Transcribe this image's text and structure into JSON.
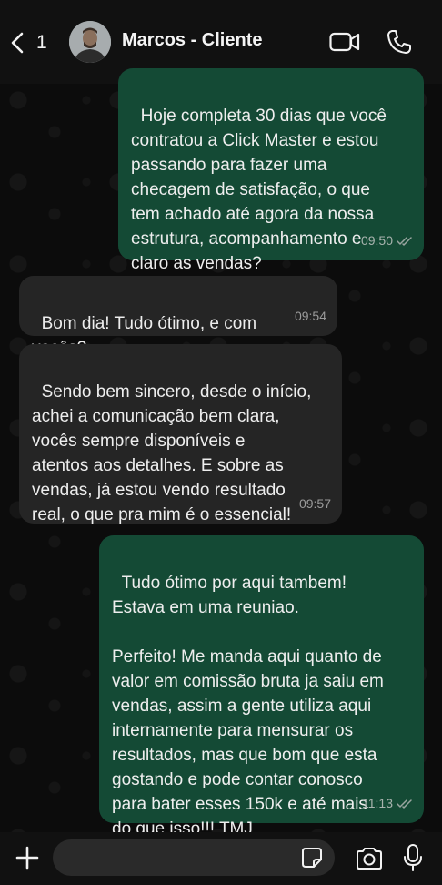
{
  "header": {
    "back_count": "1",
    "contact_name": "Marcos - Cliente"
  },
  "messages": [
    {
      "direction": "outgoing",
      "text": "Hoje completa 30 dias que você\ncontratou a Click Master e estou\npassando para fazer uma\nchecagem de satisfação, o que\ntem achado até agora da nossa\nestrutura, acompanhamento e\nclaro as vendas?",
      "time": "09:50",
      "status": "read"
    },
    {
      "direction": "incoming",
      "text": "Bom dia! Tudo ótimo, e com\nvocês?",
      "time": "09:54"
    },
    {
      "direction": "incoming",
      "text": "Sendo bem sincero, desde o início,\nachei a comunicação bem clara,\nvocês sempre disponíveis e\natentos aos detalhes. E sobre as\nvendas, já estou vendo resultado\nreal, o que pra mim é o essencial!",
      "time": "09:57"
    },
    {
      "direction": "outgoing",
      "text": "Tudo ótimo por aqui tambem!\nEstava em uma reuniao.\n\nPerfeito! Me manda aqui quanto de\nvalor em comissão bruta ja saiu em\nvendas, assim a gente utiliza aqui\ninternamente para mensurar os\nresultados, mas que bom que esta\ngostando e pode contar conosco\npara bater esses 150k e até mais\ndo que isso!!! TMJ",
      "time": "11:13",
      "status": "read"
    }
  ],
  "composer": {
    "value": ""
  },
  "colors": {
    "outgoing_bubble": "#144a35",
    "incoming_bubble": "#252525",
    "read_ticks": "#9aa5a0"
  },
  "icons": [
    "chevron-left-icon",
    "video-camera-icon",
    "phone-icon",
    "plus-icon",
    "sticker-icon",
    "camera-icon",
    "microphone-icon"
  ]
}
